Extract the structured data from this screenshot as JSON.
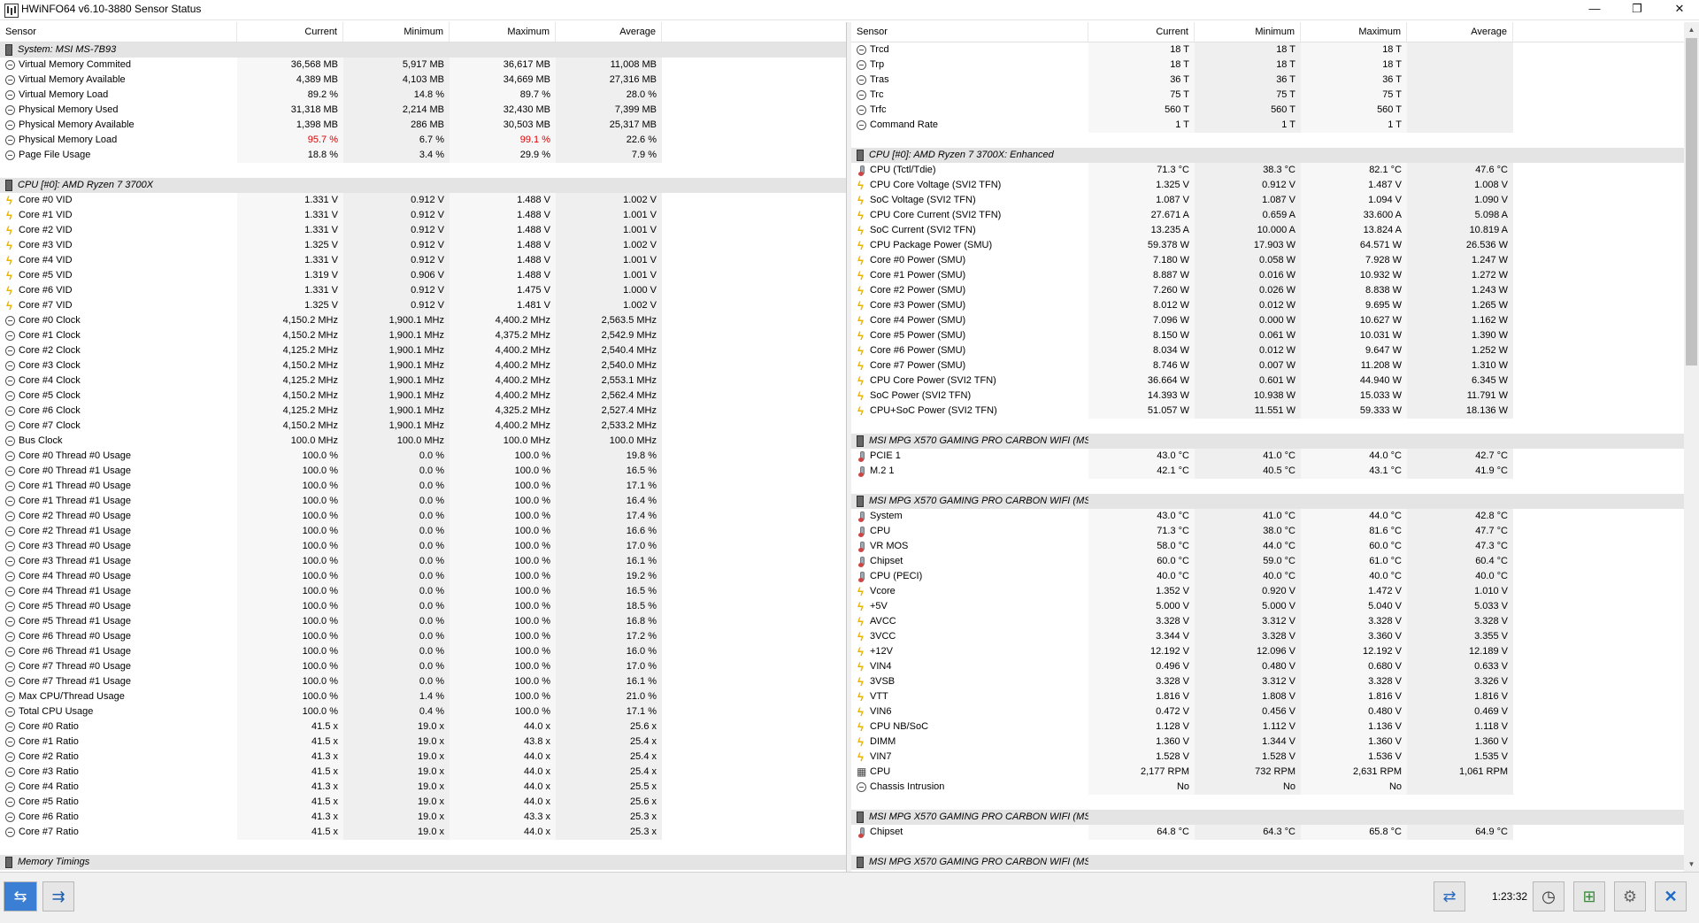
{
  "window": {
    "title": "HWiNFO64 v6.10-3880 Sensor Status",
    "minimize": "—",
    "maximize": "❐",
    "close": "✕"
  },
  "columns": [
    "Sensor",
    "Current",
    "Minimum",
    "Maximum",
    "Average"
  ],
  "left_rows": [
    {
      "type": "group",
      "name": "System: MSI MS-7B93"
    },
    {
      "icon": "clock",
      "name": "Virtual Memory Commited",
      "v": [
        "36,568 MB",
        "5,917 MB",
        "36,617 MB",
        "11,008 MB"
      ]
    },
    {
      "icon": "clock",
      "name": "Virtual Memory Available",
      "v": [
        "4,389 MB",
        "4,103 MB",
        "34,669 MB",
        "27,316 MB"
      ]
    },
    {
      "icon": "clock",
      "name": "Virtual Memory Load",
      "v": [
        "89.2 %",
        "14.8 %",
        "89.7 %",
        "28.0 %"
      ]
    },
    {
      "icon": "clock",
      "name": "Physical Memory Used",
      "v": [
        "31,318 MB",
        "2,214 MB",
        "32,430 MB",
        "7,399 MB"
      ]
    },
    {
      "icon": "clock",
      "name": "Physical Memory Available",
      "v": [
        "1,398 MB",
        "286 MB",
        "30,503 MB",
        "25,317 MB"
      ]
    },
    {
      "icon": "clock",
      "name": "Physical Memory Load",
      "v": [
        "95.7 %",
        "6.7 %",
        "99.1 %",
        "22.6 %"
      ],
      "red": [
        0,
        2
      ]
    },
    {
      "icon": "clock",
      "name": "Page File Usage",
      "v": [
        "18.8 %",
        "3.4 %",
        "29.9 %",
        "7.9 %"
      ]
    },
    {
      "type": "blank"
    },
    {
      "type": "group",
      "name": "CPU [#0]: AMD Ryzen 7 3700X"
    },
    {
      "icon": "volt",
      "name": "Core #0 VID",
      "v": [
        "1.331 V",
        "0.912 V",
        "1.488 V",
        "1.002 V"
      ]
    },
    {
      "icon": "volt",
      "name": "Core #1 VID",
      "v": [
        "1.331 V",
        "0.912 V",
        "1.488 V",
        "1.001 V"
      ]
    },
    {
      "icon": "volt",
      "name": "Core #2 VID",
      "v": [
        "1.331 V",
        "0.912 V",
        "1.488 V",
        "1.001 V"
      ]
    },
    {
      "icon": "volt",
      "name": "Core #3 VID",
      "v": [
        "1.325 V",
        "0.912 V",
        "1.488 V",
        "1.002 V"
      ]
    },
    {
      "icon": "volt",
      "name": "Core #4 VID",
      "v": [
        "1.331 V",
        "0.912 V",
        "1.488 V",
        "1.001 V"
      ]
    },
    {
      "icon": "volt",
      "name": "Core #5 VID",
      "v": [
        "1.319 V",
        "0.906 V",
        "1.488 V",
        "1.001 V"
      ]
    },
    {
      "icon": "volt",
      "name": "Core #6 VID",
      "v": [
        "1.331 V",
        "0.912 V",
        "1.475 V",
        "1.000 V"
      ]
    },
    {
      "icon": "volt",
      "name": "Core #7 VID",
      "v": [
        "1.325 V",
        "0.912 V",
        "1.481 V",
        "1.002 V"
      ]
    },
    {
      "icon": "clock",
      "name": "Core #0 Clock",
      "v": [
        "4,150.2 MHz",
        "1,900.1 MHz",
        "4,400.2 MHz",
        "2,563.5 MHz"
      ]
    },
    {
      "icon": "clock",
      "name": "Core #1 Clock",
      "v": [
        "4,150.2 MHz",
        "1,900.1 MHz",
        "4,375.2 MHz",
        "2,542.9 MHz"
      ]
    },
    {
      "icon": "clock",
      "name": "Core #2 Clock",
      "v": [
        "4,125.2 MHz",
        "1,900.1 MHz",
        "4,400.2 MHz",
        "2,540.4 MHz"
      ]
    },
    {
      "icon": "clock",
      "name": "Core #3 Clock",
      "v": [
        "4,150.2 MHz",
        "1,900.1 MHz",
        "4,400.2 MHz",
        "2,540.0 MHz"
      ]
    },
    {
      "icon": "clock",
      "name": "Core #4 Clock",
      "v": [
        "4,125.2 MHz",
        "1,900.1 MHz",
        "4,400.2 MHz",
        "2,553.1 MHz"
      ]
    },
    {
      "icon": "clock",
      "name": "Core #5 Clock",
      "v": [
        "4,150.2 MHz",
        "1,900.1 MHz",
        "4,400.2 MHz",
        "2,562.4 MHz"
      ]
    },
    {
      "icon": "clock",
      "name": "Core #6 Clock",
      "v": [
        "4,125.2 MHz",
        "1,900.1 MHz",
        "4,325.2 MHz",
        "2,527.4 MHz"
      ]
    },
    {
      "icon": "clock",
      "name": "Core #7 Clock",
      "v": [
        "4,150.2 MHz",
        "1,900.1 MHz",
        "4,400.2 MHz",
        "2,533.2 MHz"
      ]
    },
    {
      "icon": "clock",
      "name": "Bus Clock",
      "v": [
        "100.0 MHz",
        "100.0 MHz",
        "100.0 MHz",
        "100.0 MHz"
      ]
    },
    {
      "icon": "clock",
      "name": "Core #0 Thread #0 Usage",
      "v": [
        "100.0 %",
        "0.0 %",
        "100.0 %",
        "19.8 %"
      ]
    },
    {
      "icon": "clock",
      "name": "Core #0 Thread #1 Usage",
      "v": [
        "100.0 %",
        "0.0 %",
        "100.0 %",
        "16.5 %"
      ]
    },
    {
      "icon": "clock",
      "name": "Core #1 Thread #0 Usage",
      "v": [
        "100.0 %",
        "0.0 %",
        "100.0 %",
        "17.1 %"
      ]
    },
    {
      "icon": "clock",
      "name": "Core #1 Thread #1 Usage",
      "v": [
        "100.0 %",
        "0.0 %",
        "100.0 %",
        "16.4 %"
      ]
    },
    {
      "icon": "clock",
      "name": "Core #2 Thread #0 Usage",
      "v": [
        "100.0 %",
        "0.0 %",
        "100.0 %",
        "17.4 %"
      ]
    },
    {
      "icon": "clock",
      "name": "Core #2 Thread #1 Usage",
      "v": [
        "100.0 %",
        "0.0 %",
        "100.0 %",
        "16.6 %"
      ]
    },
    {
      "icon": "clock",
      "name": "Core #3 Thread #0 Usage",
      "v": [
        "100.0 %",
        "0.0 %",
        "100.0 %",
        "17.0 %"
      ]
    },
    {
      "icon": "clock",
      "name": "Core #3 Thread #1 Usage",
      "v": [
        "100.0 %",
        "0.0 %",
        "100.0 %",
        "16.1 %"
      ]
    },
    {
      "icon": "clock",
      "name": "Core #4 Thread #0 Usage",
      "v": [
        "100.0 %",
        "0.0 %",
        "100.0 %",
        "19.2 %"
      ]
    },
    {
      "icon": "clock",
      "name": "Core #4 Thread #1 Usage",
      "v": [
        "100.0 %",
        "0.0 %",
        "100.0 %",
        "16.5 %"
      ]
    },
    {
      "icon": "clock",
      "name": "Core #5 Thread #0 Usage",
      "v": [
        "100.0 %",
        "0.0 %",
        "100.0 %",
        "18.5 %"
      ]
    },
    {
      "icon": "clock",
      "name": "Core #5 Thread #1 Usage",
      "v": [
        "100.0 %",
        "0.0 %",
        "100.0 %",
        "16.8 %"
      ]
    },
    {
      "icon": "clock",
      "name": "Core #6 Thread #0 Usage",
      "v": [
        "100.0 %",
        "0.0 %",
        "100.0 %",
        "17.2 %"
      ]
    },
    {
      "icon": "clock",
      "name": "Core #6 Thread #1 Usage",
      "v": [
        "100.0 %",
        "0.0 %",
        "100.0 %",
        "16.0 %"
      ]
    },
    {
      "icon": "clock",
      "name": "Core #7 Thread #0 Usage",
      "v": [
        "100.0 %",
        "0.0 %",
        "100.0 %",
        "17.0 %"
      ]
    },
    {
      "icon": "clock",
      "name": "Core #7 Thread #1 Usage",
      "v": [
        "100.0 %",
        "0.0 %",
        "100.0 %",
        "16.1 %"
      ]
    },
    {
      "icon": "clock",
      "name": "Max CPU/Thread Usage",
      "v": [
        "100.0 %",
        "1.4 %",
        "100.0 %",
        "21.0 %"
      ]
    },
    {
      "icon": "clock",
      "name": "Total CPU Usage",
      "v": [
        "100.0 %",
        "0.4 %",
        "100.0 %",
        "17.1 %"
      ]
    },
    {
      "icon": "clock",
      "name": "Core #0 Ratio",
      "v": [
        "41.5 x",
        "19.0 x",
        "44.0 x",
        "25.6 x"
      ]
    },
    {
      "icon": "clock",
      "name": "Core #1 Ratio",
      "v": [
        "41.5 x",
        "19.0 x",
        "43.8 x",
        "25.4 x"
      ]
    },
    {
      "icon": "clock",
      "name": "Core #2 Ratio",
      "v": [
        "41.3 x",
        "19.0 x",
        "44.0 x",
        "25.4 x"
      ]
    },
    {
      "icon": "clock",
      "name": "Core #3 Ratio",
      "v": [
        "41.5 x",
        "19.0 x",
        "44.0 x",
        "25.4 x"
      ]
    },
    {
      "icon": "clock",
      "name": "Core #4 Ratio",
      "v": [
        "41.3 x",
        "19.0 x",
        "44.0 x",
        "25.5 x"
      ]
    },
    {
      "icon": "clock",
      "name": "Core #5 Ratio",
      "v": [
        "41.5 x",
        "19.0 x",
        "44.0 x",
        "25.6 x"
      ]
    },
    {
      "icon": "clock",
      "name": "Core #6 Ratio",
      "v": [
        "41.3 x",
        "19.0 x",
        "43.3 x",
        "25.3 x"
      ]
    },
    {
      "icon": "clock",
      "name": "Core #7 Ratio",
      "v": [
        "41.5 x",
        "19.0 x",
        "44.0 x",
        "25.3 x"
      ]
    },
    {
      "type": "blank"
    },
    {
      "type": "group",
      "name": "Memory Timings"
    }
  ],
  "right_rows": [
    {
      "icon": "clock",
      "name": "Trcd",
      "v": [
        "18 T",
        "18 T",
        "18 T",
        ""
      ]
    },
    {
      "icon": "clock",
      "name": "Trp",
      "v": [
        "18 T",
        "18 T",
        "18 T",
        ""
      ]
    },
    {
      "icon": "clock",
      "name": "Tras",
      "v": [
        "36 T",
        "36 T",
        "36 T",
        ""
      ]
    },
    {
      "icon": "clock",
      "name": "Trc",
      "v": [
        "75 T",
        "75 T",
        "75 T",
        ""
      ]
    },
    {
      "icon": "clock",
      "name": "Trfc",
      "v": [
        "560 T",
        "560 T",
        "560 T",
        ""
      ]
    },
    {
      "icon": "clock",
      "name": "Command Rate",
      "v": [
        "1 T",
        "1 T",
        "1 T",
        ""
      ]
    },
    {
      "type": "blank"
    },
    {
      "type": "group",
      "name": "CPU [#0]: AMD Ryzen 7 3700X: Enhanced"
    },
    {
      "icon": "temp",
      "name": "CPU (Tctl/Tdie)",
      "v": [
        "71.3 °C",
        "38.3 °C",
        "82.1 °C",
        "47.6 °C"
      ]
    },
    {
      "icon": "volt",
      "name": "CPU Core Voltage (SVI2 TFN)",
      "v": [
        "1.325 V",
        "0.912 V",
        "1.487 V",
        "1.008 V"
      ]
    },
    {
      "icon": "volt",
      "name": "SoC Voltage (SVI2 TFN)",
      "v": [
        "1.087 V",
        "1.087 V",
        "1.094 V",
        "1.090 V"
      ]
    },
    {
      "icon": "volt",
      "name": "CPU Core Current (SVI2 TFN)",
      "v": [
        "27.671 A",
        "0.659 A",
        "33.600 A",
        "5.098 A"
      ]
    },
    {
      "icon": "volt",
      "name": "SoC Current (SVI2 TFN)",
      "v": [
        "13.235 A",
        "10.000 A",
        "13.824 A",
        "10.819 A"
      ]
    },
    {
      "icon": "volt",
      "name": "CPU Package Power (SMU)",
      "v": [
        "59.378 W",
        "17.903 W",
        "64.571 W",
        "26.536 W"
      ]
    },
    {
      "icon": "volt",
      "name": "Core #0 Power (SMU)",
      "v": [
        "7.180 W",
        "0.058 W",
        "7.928 W",
        "1.247 W"
      ]
    },
    {
      "icon": "volt",
      "name": "Core #1 Power (SMU)",
      "v": [
        "8.887 W",
        "0.016 W",
        "10.932 W",
        "1.272 W"
      ]
    },
    {
      "icon": "volt",
      "name": "Core #2 Power (SMU)",
      "v": [
        "7.260 W",
        "0.026 W",
        "8.838 W",
        "1.243 W"
      ]
    },
    {
      "icon": "volt",
      "name": "Core #3 Power (SMU)",
      "v": [
        "8.012 W",
        "0.012 W",
        "9.695 W",
        "1.265 W"
      ]
    },
    {
      "icon": "volt",
      "name": "Core #4 Power (SMU)",
      "v": [
        "7.096 W",
        "0.000 W",
        "10.627 W",
        "1.162 W"
      ]
    },
    {
      "icon": "volt",
      "name": "Core #5 Power (SMU)",
      "v": [
        "8.150 W",
        "0.061 W",
        "10.031 W",
        "1.390 W"
      ]
    },
    {
      "icon": "volt",
      "name": "Core #6 Power (SMU)",
      "v": [
        "8.034 W",
        "0.012 W",
        "9.647 W",
        "1.252 W"
      ]
    },
    {
      "icon": "volt",
      "name": "Core #7 Power (SMU)",
      "v": [
        "8.746 W",
        "0.007 W",
        "11.208 W",
        "1.310 W"
      ]
    },
    {
      "icon": "volt",
      "name": "CPU Core Power (SVI2 TFN)",
      "v": [
        "36.664 W",
        "0.601 W",
        "44.940 W",
        "6.345 W"
      ]
    },
    {
      "icon": "volt",
      "name": "SoC Power (SVI2 TFN)",
      "v": [
        "14.393 W",
        "10.938 W",
        "15.033 W",
        "11.791 W"
      ]
    },
    {
      "icon": "volt",
      "name": "CPU+SoC Power (SVI2 TFN)",
      "v": [
        "51.057 W",
        "11.551 W",
        "59.333 W",
        "18.136 W"
      ]
    },
    {
      "type": "blank"
    },
    {
      "type": "group",
      "name": "MSI MPG X570 GAMING PRO CARBON WIFI (MS..."
    },
    {
      "icon": "temp",
      "name": "PCIE 1",
      "v": [
        "43.0 °C",
        "41.0 °C",
        "44.0 °C",
        "42.7 °C"
      ]
    },
    {
      "icon": "temp",
      "name": "M.2 1",
      "v": [
        "42.1 °C",
        "40.5 °C",
        "43.1 °C",
        "41.9 °C"
      ]
    },
    {
      "type": "blank"
    },
    {
      "type": "group",
      "name": "MSI MPG X570 GAMING PRO CARBON WIFI (MS..."
    },
    {
      "icon": "temp",
      "name": "System",
      "v": [
        "43.0 °C",
        "41.0 °C",
        "44.0 °C",
        "42.8 °C"
      ]
    },
    {
      "icon": "temp",
      "name": "CPU",
      "v": [
        "71.3 °C",
        "38.0 °C",
        "81.6 °C",
        "47.7 °C"
      ]
    },
    {
      "icon": "temp",
      "name": "VR MOS",
      "v": [
        "58.0 °C",
        "44.0 °C",
        "60.0 °C",
        "47.3 °C"
      ]
    },
    {
      "icon": "temp",
      "name": "Chipset",
      "v": [
        "60.0 °C",
        "59.0 °C",
        "61.0 °C",
        "60.4 °C"
      ]
    },
    {
      "icon": "temp",
      "name": "CPU (PECI)",
      "v": [
        "40.0 °C",
        "40.0 °C",
        "40.0 °C",
        "40.0 °C"
      ]
    },
    {
      "icon": "volt",
      "name": "Vcore",
      "v": [
        "1.352 V",
        "0.920 V",
        "1.472 V",
        "1.010 V"
      ]
    },
    {
      "icon": "volt",
      "name": "+5V",
      "v": [
        "5.000 V",
        "5.000 V",
        "5.040 V",
        "5.033 V"
      ]
    },
    {
      "icon": "volt",
      "name": "AVCC",
      "v": [
        "3.328 V",
        "3.312 V",
        "3.328 V",
        "3.328 V"
      ]
    },
    {
      "icon": "volt",
      "name": "3VCC",
      "v": [
        "3.344 V",
        "3.328 V",
        "3.360 V",
        "3.355 V"
      ]
    },
    {
      "icon": "volt",
      "name": "+12V",
      "v": [
        "12.192 V",
        "12.096 V",
        "12.192 V",
        "12.189 V"
      ]
    },
    {
      "icon": "volt",
      "name": "VIN4",
      "v": [
        "0.496 V",
        "0.480 V",
        "0.680 V",
        "0.633 V"
      ]
    },
    {
      "icon": "volt",
      "name": "3VSB",
      "v": [
        "3.328 V",
        "3.312 V",
        "3.328 V",
        "3.326 V"
      ]
    },
    {
      "icon": "volt",
      "name": "VTT",
      "v": [
        "1.816 V",
        "1.808 V",
        "1.816 V",
        "1.816 V"
      ]
    },
    {
      "icon": "volt",
      "name": "VIN6",
      "v": [
        "0.472 V",
        "0.456 V",
        "0.480 V",
        "0.469 V"
      ]
    },
    {
      "icon": "volt",
      "name": "CPU NB/SoC",
      "v": [
        "1.128 V",
        "1.112 V",
        "1.136 V",
        "1.118 V"
      ]
    },
    {
      "icon": "volt",
      "name": "DIMM",
      "v": [
        "1.360 V",
        "1.344 V",
        "1.360 V",
        "1.360 V"
      ]
    },
    {
      "icon": "volt",
      "name": "VIN7",
      "v": [
        "1.528 V",
        "1.528 V",
        "1.536 V",
        "1.535 V"
      ]
    },
    {
      "icon": "fan",
      "name": "CPU",
      "v": [
        "2,177 RPM",
        "732 RPM",
        "2,631 RPM",
        "1,061 RPM"
      ]
    },
    {
      "icon": "clock",
      "name": "Chassis Intrusion",
      "v": [
        "No",
        "No",
        "No",
        ""
      ]
    },
    {
      "type": "blank"
    },
    {
      "type": "group",
      "name": "MSI MPG X570 GAMING PRO CARBON WIFI (MS..."
    },
    {
      "icon": "temp",
      "name": "Chipset",
      "v": [
        "64.8 °C",
        "64.3 °C",
        "65.8 °C",
        "64.9 °C"
      ]
    },
    {
      "type": "blank"
    },
    {
      "type": "group",
      "name": "MSI MPG X570 GAMING PRO CARBON WIFI (MS..."
    }
  ],
  "toolbar": {
    "nav_prev_icon": "⇆",
    "nav_next_icon": "⇉",
    "elapsed": "1:23:32",
    "icons": [
      "network-icon",
      "clock-icon",
      "add-report-icon",
      "settings-icon",
      "close-icon"
    ]
  },
  "colors": {
    "alert": "#e00000",
    "group_bg": "#e4e4e4"
  }
}
